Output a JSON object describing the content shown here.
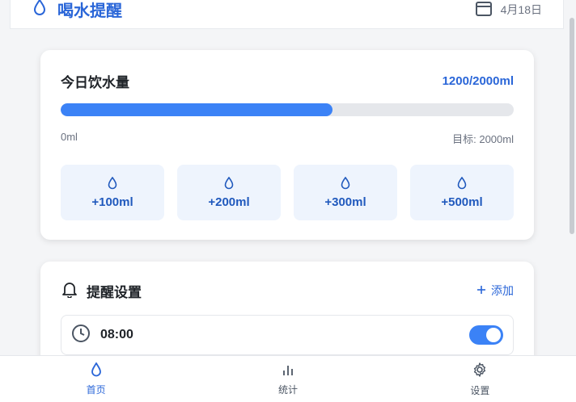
{
  "header": {
    "title": "喝水提醒",
    "date": "4月18日",
    "brand_icon": "water-drop-icon",
    "date_icon": "calendar-icon"
  },
  "intake": {
    "label": "今日饮水量",
    "amount": "1200/2000ml",
    "progress_percent": 60,
    "min_label": "0ml",
    "goal_label": "目标: 2000ml",
    "quick_add": [
      {
        "label": "+100ml",
        "icon": "water-drop-icon"
      },
      {
        "label": "+200ml",
        "icon": "water-drop-icon"
      },
      {
        "label": "+300ml",
        "icon": "water-drop-icon"
      },
      {
        "label": "+500ml",
        "icon": "water-drop-icon"
      }
    ]
  },
  "reminders": {
    "title": "提醒设置",
    "title_icon": "bell-icon",
    "add_label": "添加",
    "items": [
      {
        "time": "08:00",
        "enabled": true,
        "icon": "clock-icon"
      }
    ]
  },
  "nav": {
    "items": [
      {
        "label": "首页",
        "icon": "water-drop-icon",
        "active": true
      },
      {
        "label": "统计",
        "icon": "bar-chart-icon",
        "active": false
      },
      {
        "label": "设置",
        "icon": "gear-icon",
        "active": false
      }
    ]
  },
  "colors": {
    "accent": "#3b82f6",
    "accent_text": "#2a66d8",
    "quick_bg": "#eef4fd",
    "track": "#e5e7eb"
  }
}
